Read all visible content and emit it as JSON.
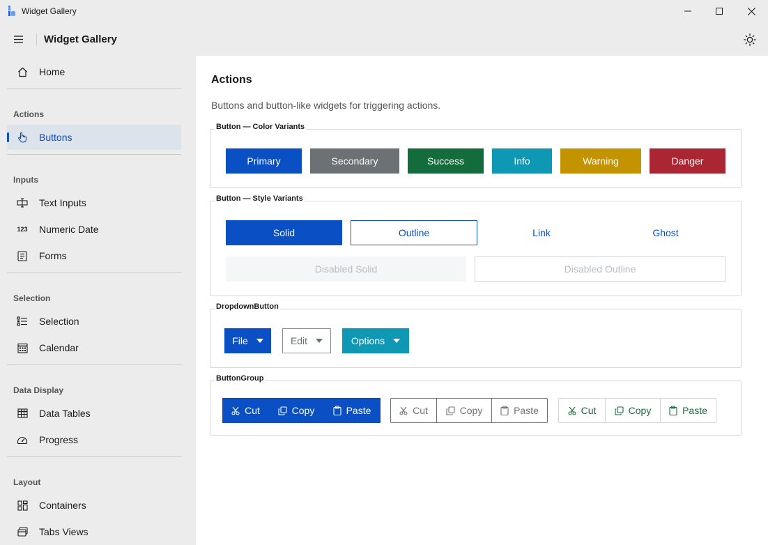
{
  "window": {
    "title": "Widget Gallery"
  },
  "header": {
    "title": "Widget Gallery"
  },
  "sidebar": {
    "home": "Home",
    "sections": {
      "actions": "Actions",
      "inputs": "Inputs",
      "selection": "Selection",
      "data_display": "Data Display",
      "layout": "Layout"
    },
    "items": {
      "buttons": "Buttons",
      "text_inputs": "Text Inputs",
      "numeric_date": "Numeric Date",
      "numeric_date_icon_text": "123",
      "forms": "Forms",
      "selection": "Selection",
      "calendar": "Calendar",
      "data_tables": "Data Tables",
      "progress": "Progress",
      "containers": "Containers",
      "tabs_views": "Tabs Views"
    },
    "active_item": "Buttons"
  },
  "main": {
    "title": "Actions",
    "description": "Buttons and button-like widgets for triggering actions.",
    "color_variants": {
      "label": "Button — Color Variants",
      "primary": "Primary",
      "secondary": "Secondary",
      "success": "Success",
      "info": "Info",
      "warning": "Warning",
      "danger": "Danger"
    },
    "style_variants": {
      "label": "Button — Style Variants",
      "solid": "Solid",
      "outline": "Outline",
      "link": "Link",
      "ghost": "Ghost",
      "disabled_solid": "Disabled Solid",
      "disabled_outline": "Disabled Outline"
    },
    "dropdown": {
      "label": "DropdownButton",
      "file": "File",
      "edit": "Edit",
      "options": "Options"
    },
    "button_group": {
      "label": "ButtonGroup",
      "cut": "Cut",
      "copy": "Copy",
      "paste": "Paste"
    }
  },
  "colors": {
    "primary": "#0b4fc4",
    "secondary": "#6c7175",
    "success": "#146c3c",
    "info": "#0f98b4",
    "warning": "#c39300",
    "danger": "#aa2633",
    "sidebar_active_bg": "#dde3ea",
    "disabled_bg": "#f4f6f7",
    "disabled_text": "#b8bdc2"
  },
  "icons": {
    "app": "widget-gallery-logo",
    "minimize": "minimize-icon",
    "maximize": "maximize-icon",
    "close": "close-icon",
    "menu": "hamburger-icon",
    "theme": "sun-icon"
  }
}
